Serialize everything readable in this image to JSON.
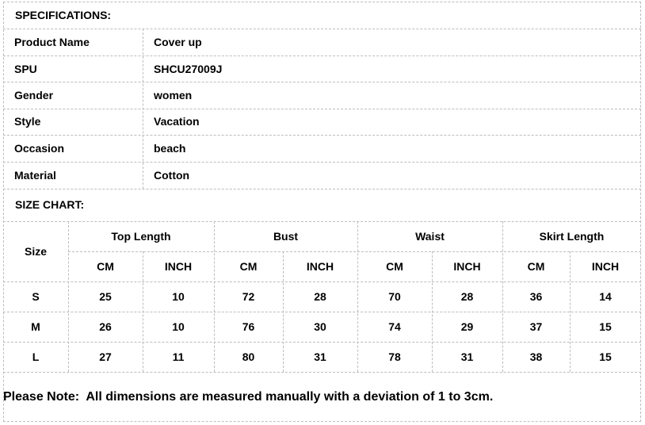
{
  "specifications": {
    "heading": "SPECIFICATIONS:",
    "rows": [
      {
        "label": "Product  Name",
        "value": "Cover up"
      },
      {
        "label": "SPU",
        "value": "SHCU27009J"
      },
      {
        "label": "Gender",
        "value": "women"
      },
      {
        "label": "Style",
        "value": "Vacation"
      },
      {
        "label": "Occasion",
        "value": "beach"
      },
      {
        "label": "Material",
        "value": "Cotton"
      }
    ]
  },
  "size_chart": {
    "heading": "SIZE CHART:",
    "size_header": "Size",
    "groups": [
      "Top Length",
      "Bust",
      "Waist",
      "Skirt Length"
    ],
    "units": [
      "CM",
      "INCH",
      "CM",
      "INCH",
      "CM",
      "INCH",
      "CM",
      "INCH"
    ],
    "rows": [
      {
        "size": "S",
        "values": [
          "25",
          "10",
          "72",
          "28",
          "70",
          "28",
          "36",
          "14"
        ]
      },
      {
        "size": "M",
        "values": [
          "26",
          "10",
          "76",
          "30",
          "74",
          "29",
          "37",
          "15"
        ]
      },
      {
        "size": "L",
        "values": [
          "27",
          "11",
          "80",
          "31",
          "78",
          "31",
          "38",
          "15"
        ]
      }
    ]
  },
  "note": "Please Note:  All dimensions are measured manually with a deviation of 1 to 3cm."
}
